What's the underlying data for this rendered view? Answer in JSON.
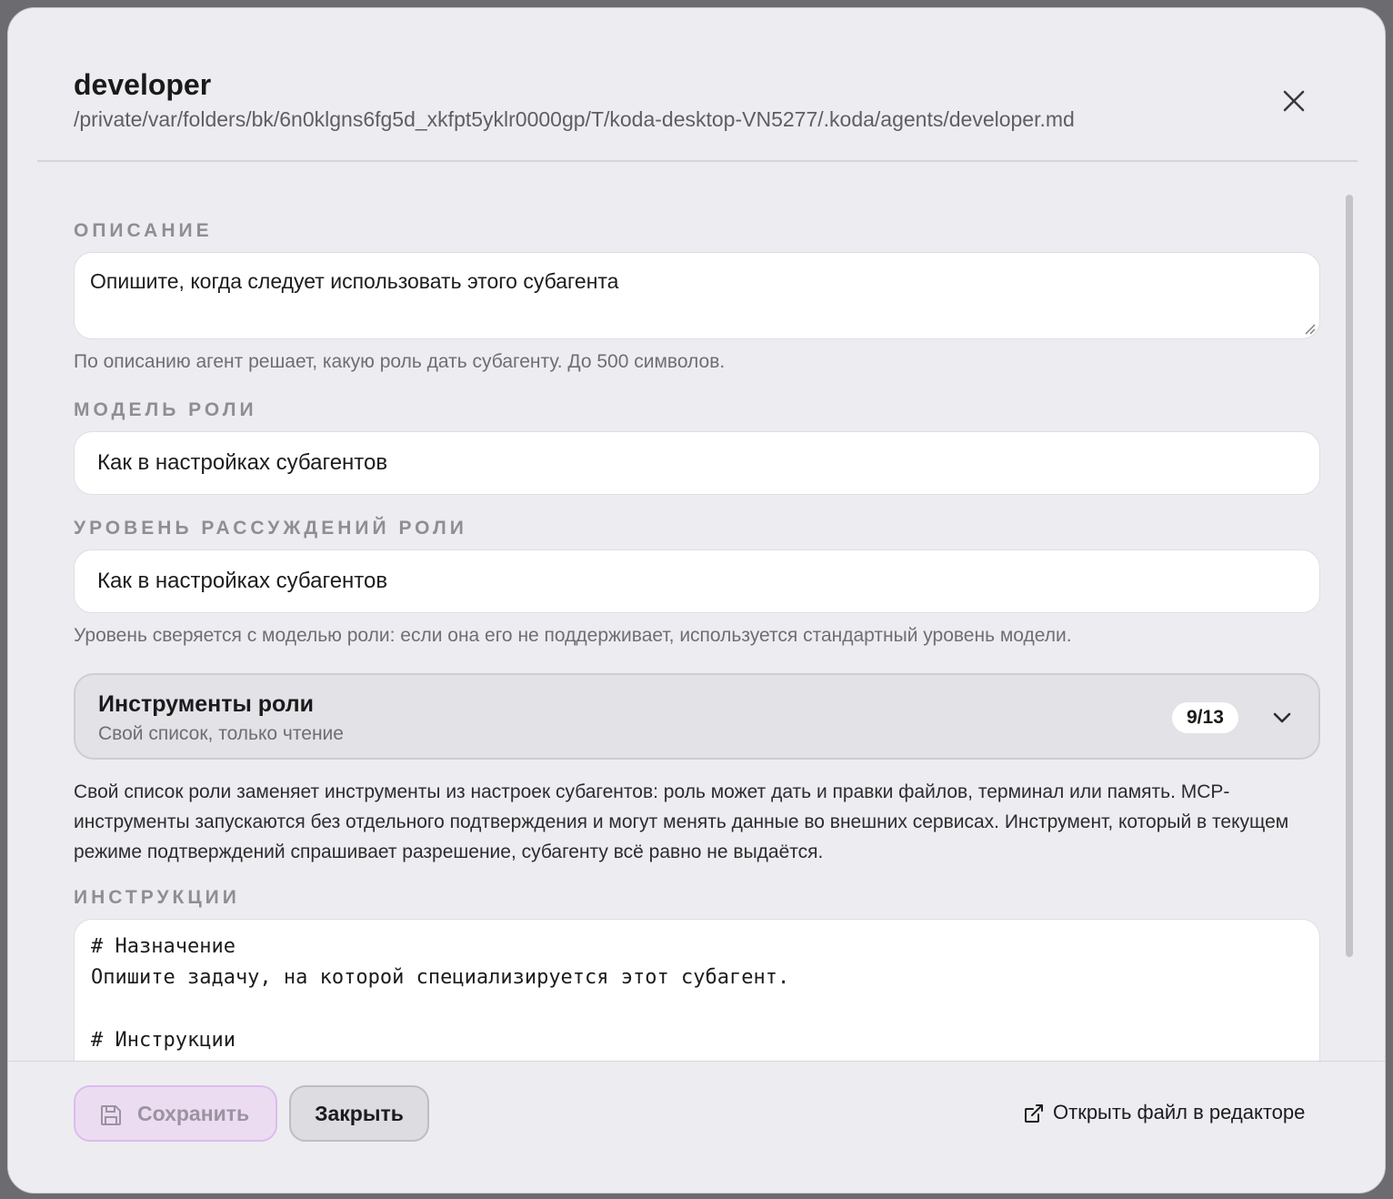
{
  "dialog": {
    "title": "developer",
    "path": "/private/var/folders/bk/6n0klgns6fg5d_xkfpt5yklr0000gp/T/koda-desktop-VN5277/.koda/agents/developer.md",
    "close_icon": "close-icon"
  },
  "description": {
    "label": "ОПИСАНИЕ",
    "placeholder": "Опишите, когда следует использовать этого субагента",
    "hint": "По описанию агент решает, какую роль дать субагенту. До 500 символов."
  },
  "model": {
    "label": "МОДЕЛЬ РОЛИ",
    "value": "Как в настройках субагентов"
  },
  "reasoning": {
    "label": "УРОВЕНЬ РАССУЖДЕНИЙ РОЛИ",
    "value": "Как в настройках субагентов",
    "hint": "Уровень сверяется с моделью роли: если она его не поддерживает, используется стандартный уровень модели."
  },
  "tools": {
    "title": "Инструменты роли",
    "subtitle": "Свой список, только чтение",
    "count": "9/13",
    "chevron_icon": "chevron-down-icon",
    "note": "Свой список роли заменяет инструменты из настроек субагентов: роль может дать и правки файлов, терминал или память. MCP-инструменты запускаются без отдельного подтверждения и могут менять данные во внешних сервисах. Инструмент, который в текущем режиме подтверждений спрашивает разрешение, субагенту всё равно не выдаётся."
  },
  "instructions": {
    "label": "ИНСТРУКЦИИ",
    "lines": [
      "# Назначение",
      "Опишите задачу, на которой специализируется этот субагент.",
      "",
      "# Инструкции"
    ]
  },
  "footer": {
    "save_label": "Сохранить",
    "save_icon": "save-icon",
    "close_label": "Закрыть",
    "open_editor_label": "Открыть файл в редакторе",
    "open_editor_icon": "external-link-icon"
  },
  "colors": {
    "accent_disabled": "#ecdcf2",
    "background": "#ededf1"
  }
}
